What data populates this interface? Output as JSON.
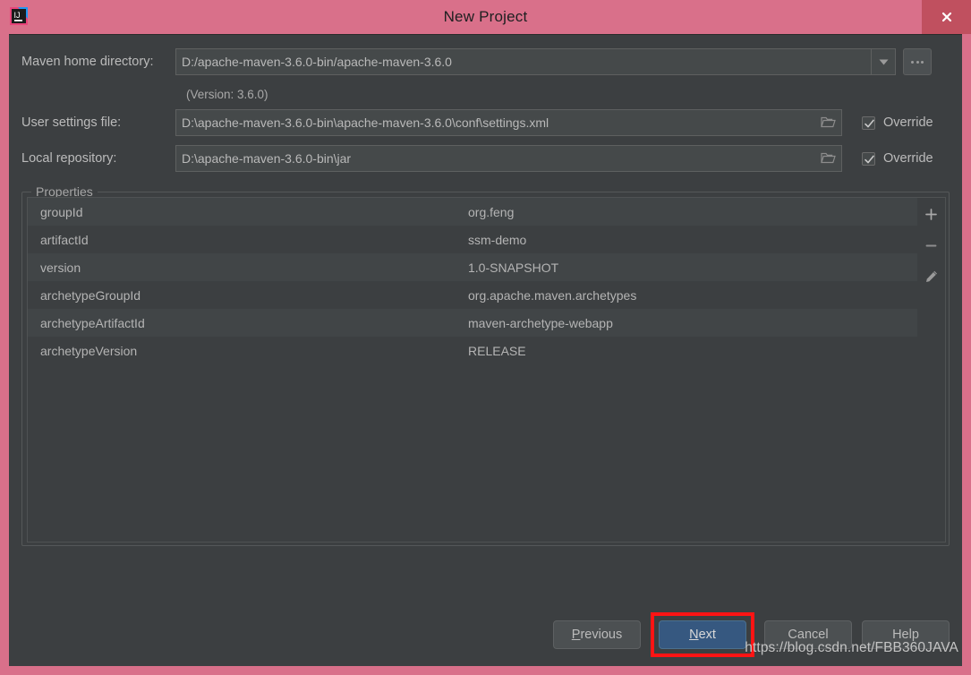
{
  "window": {
    "title": "New Project",
    "app_icon": "intellij-idea-icon",
    "close_label": "x",
    "frame_color": "#d9708a",
    "dialog_bg": "#3c3f41"
  },
  "form": {
    "maven_home": {
      "label": "Maven home directory:",
      "value": "D:/apache-maven-3.6.0-bin/apache-maven-3.6.0",
      "dropdown_icon": "chevron-down-icon",
      "browse_label": "..."
    },
    "version_note": "(Version: 3.6.0)",
    "user_settings": {
      "label": "User settings file:",
      "value": "D:\\apache-maven-3.6.0-bin\\apache-maven-3.6.0\\conf\\settings.xml",
      "folder_icon": "folder-icon",
      "override_label": "Override",
      "override_checked": true
    },
    "local_repository": {
      "label": "Local repository:",
      "value": "D:\\apache-maven-3.6.0-bin\\jar",
      "folder_icon": "folder-icon",
      "override_label": "Override",
      "override_checked": true
    }
  },
  "properties": {
    "title": "Properties",
    "rows": [
      {
        "key": "groupId",
        "value": "org.feng"
      },
      {
        "key": "artifactId",
        "value": "ssm-demo"
      },
      {
        "key": "version",
        "value": "1.0-SNAPSHOT"
      },
      {
        "key": "archetypeGroupId",
        "value": "org.apache.maven.archetypes"
      },
      {
        "key": "archetypeArtifactId",
        "value": "maven-archetype-webapp"
      },
      {
        "key": "archetypeVersion",
        "value": "RELEASE"
      }
    ],
    "toolbar": {
      "add_icon": "plus-icon",
      "remove_icon": "minus-icon",
      "edit_icon": "pencil-icon"
    }
  },
  "footer": {
    "previous": {
      "prefix": "",
      "mnemonic": "P",
      "suffix": "revious"
    },
    "next": {
      "prefix": "",
      "mnemonic": "N",
      "suffix": "ext",
      "highlighted": true,
      "accent": "#365880",
      "highlight_color": "#ff1414"
    },
    "cancel": "Cancel",
    "help": "Help"
  },
  "watermark": "https://blog.csdn.net/FBB360JAVA"
}
